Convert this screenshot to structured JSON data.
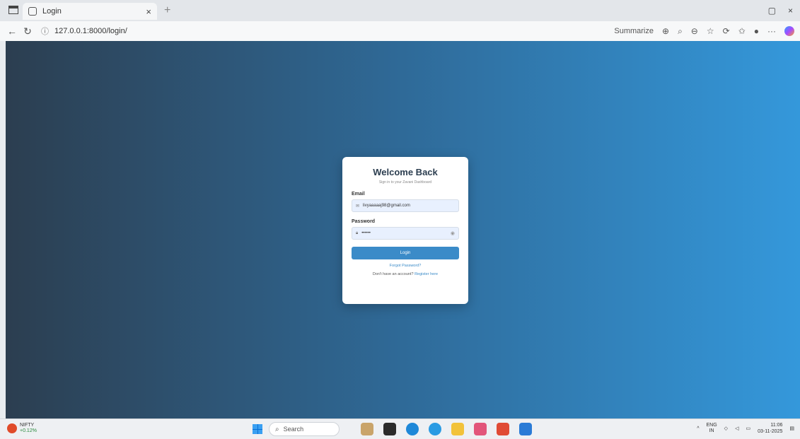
{
  "browser": {
    "tab_title": "Login",
    "tab_close": "×",
    "new_tab": "+",
    "url": "127.0.0.1:8000/login/",
    "summarize_label": "Summarize",
    "window_minimize": "▢",
    "window_close": "×"
  },
  "login": {
    "heading": "Welcome Back",
    "subtitle": "Sign in to your Zavani Dashboard",
    "email_label": "Email",
    "email_value": "livyaaaaaj98@gmail.com",
    "password_label": "Password",
    "password_value": "••••••",
    "login_button": "Login",
    "forgot_link": "Forgot Password?",
    "register_text": "Don't have an account?",
    "register_link": "Register here"
  },
  "taskbar": {
    "ticker_name": "NIFTY",
    "ticker_change": "+0.12%",
    "search_placeholder": "Search",
    "lang_top": "ENG",
    "lang_bottom": "IN",
    "time": "11:06",
    "date": "03-11-2025"
  },
  "colors": {
    "gradient_start": "#2c3e50",
    "gradient_end": "#3498db",
    "button": "#3b8bc8"
  }
}
